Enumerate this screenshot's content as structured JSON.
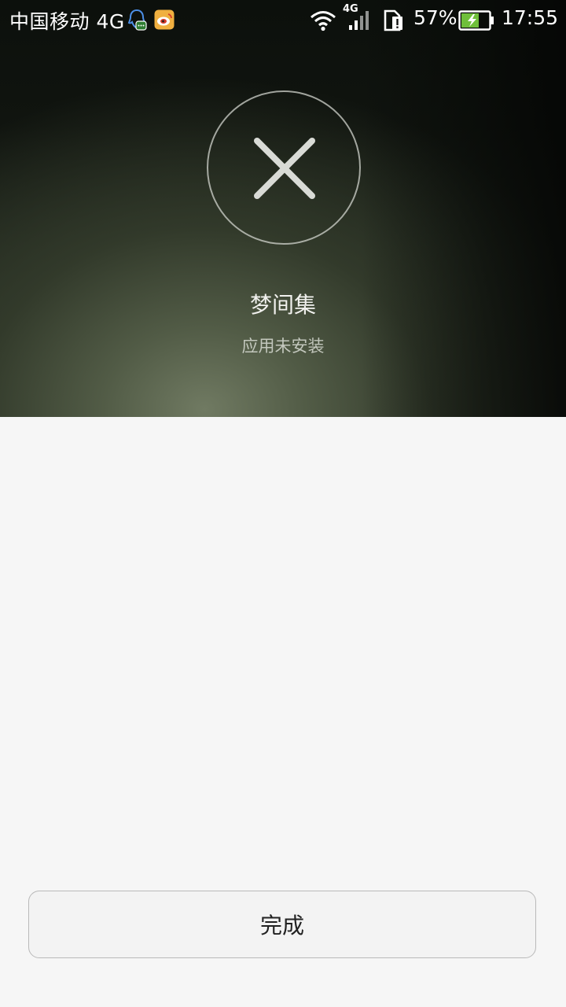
{
  "status_bar": {
    "carrier": "中国移动 4G",
    "network_badge": "4G",
    "battery_percent": "57%",
    "time": "17:55",
    "icons": [
      "qq-icon",
      "weibo-icon",
      "wifi-icon",
      "signal-icon",
      "sim-alert-icon",
      "battery-charging-icon"
    ]
  },
  "result": {
    "icon": "close-icon",
    "app_name": "梦间集",
    "status": "应用未安装"
  },
  "footer": {
    "done_label": "完成"
  },
  "colors": {
    "battery_fill": "#6fbf3a",
    "page_background": "#f6f6f6"
  }
}
